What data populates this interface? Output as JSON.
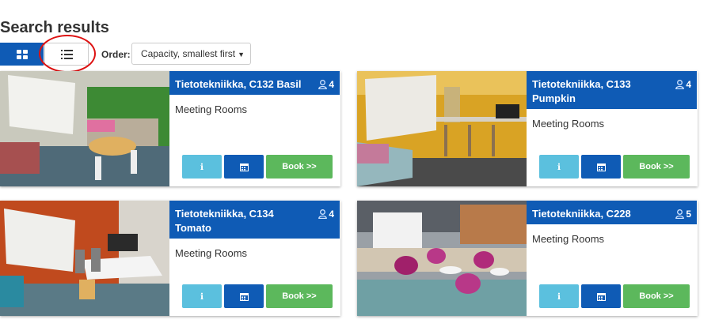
{
  "page": {
    "title": "Search results"
  },
  "toolbar": {
    "view_grid_icon": "grid-view-icon",
    "view_list_icon": "list-view-icon",
    "order_label": "Order:",
    "order_value": "Capacity, smallest first"
  },
  "colors": {
    "primary": "#0f5bb5",
    "info": "#5bc0de",
    "success": "#5cb85c",
    "annotation": "#dd1111"
  },
  "rooms": [
    {
      "name": "Tietotekniikka, C132 Basil",
      "capacity": "4",
      "category": "Meeting Rooms",
      "book_label": "Book >>",
      "photo": "meeting room with green wall, whiteboard and round table"
    },
    {
      "name": "Tietotekniikka, C133 Pumpkin",
      "capacity": "4",
      "category": "Meeting Rooms",
      "book_label": "Book >>",
      "photo": "meeting room with yellow walls, whiteboard and desk"
    },
    {
      "name": "Tietotekniikka, C134 Tomato",
      "capacity": "4",
      "category": "Meeting Rooms",
      "book_label": "Book >>",
      "photo": "meeting room with orange wall, whiteboard and white table"
    },
    {
      "name": "Tietotekniikka, C228",
      "capacity": "5",
      "category": "Meeting Rooms",
      "book_label": "Book >>",
      "photo": "open lounge with whiteboard and pink chairs"
    }
  ]
}
